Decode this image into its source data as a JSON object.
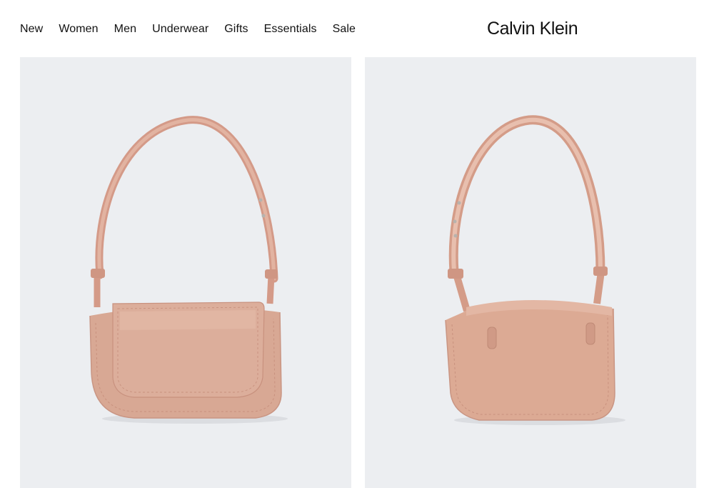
{
  "header": {
    "nav": [
      {
        "label": "New"
      },
      {
        "label": "Women"
      },
      {
        "label": "Men"
      },
      {
        "label": "Underwear"
      },
      {
        "label": "Gifts"
      },
      {
        "label": "Essentials"
      },
      {
        "label": "Sale"
      }
    ],
    "brand": "Calvin Klein"
  },
  "gallery": {
    "images": [
      {
        "view": "front",
        "color": "#d8a894"
      },
      {
        "view": "back",
        "color": "#dcaa94"
      }
    ],
    "background": "#eceef1"
  }
}
